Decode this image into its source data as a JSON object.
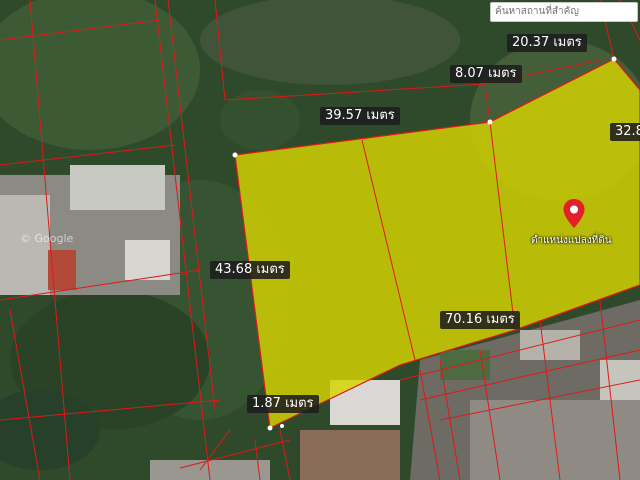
{
  "search": {
    "placeholder": "ค้นหาสถานที่สำคัญ"
  },
  "measurements": [
    "20.37 เมตร",
    "8.07 เมตร",
    "39.57 เมตร",
    "32.8",
    "43.68 เมตร",
    "70.16 เมตร",
    "1.87 เมตร"
  ],
  "pin": {
    "label": "ตำแหน่งแปลงที่ดิน",
    "icon": "location-pin-icon"
  },
  "watermark": "© Google",
  "colors": {
    "parcel_fill": "#d7d400",
    "parcel_line": "#e01818",
    "pin": "#e3202a"
  }
}
